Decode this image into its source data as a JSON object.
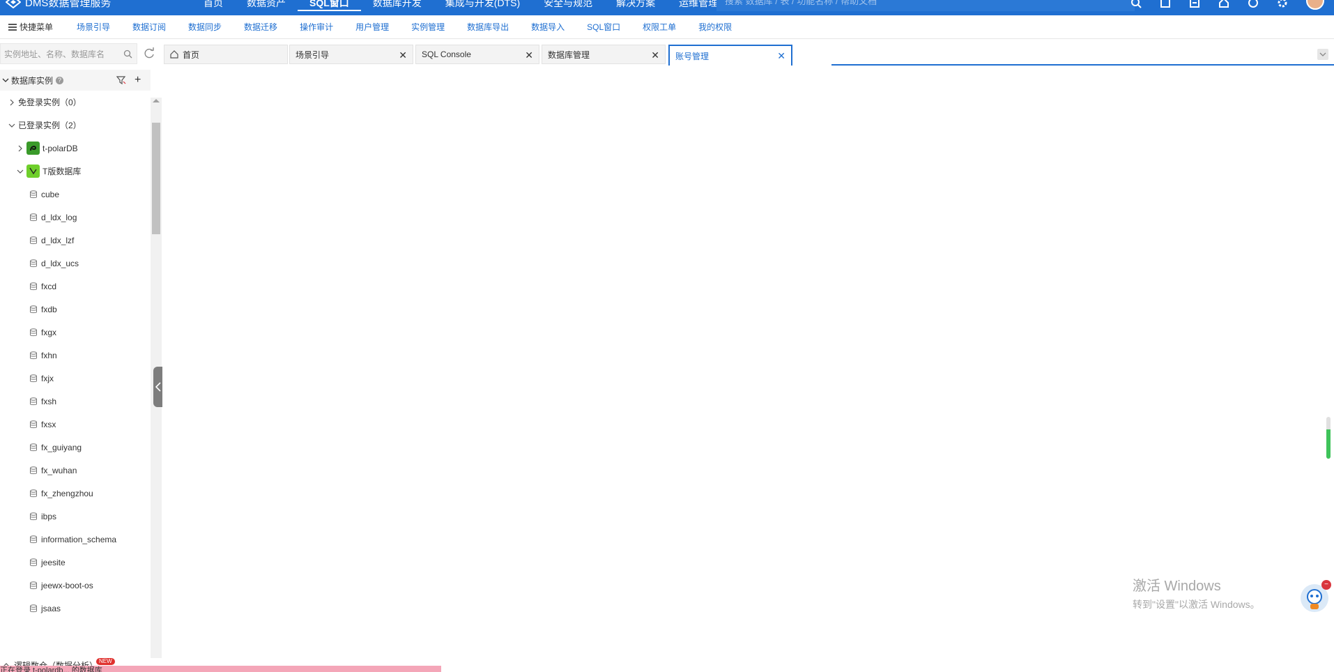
{
  "header": {
    "app_title": "DMS数据管理服务",
    "nav": [
      "首页",
      "数据资产",
      "SQL窗口",
      "数据库开发",
      "集成与开发(DTS)",
      "安全与规范",
      "解决方案",
      "运维管理"
    ],
    "active_nav_index": 2,
    "search_placeholder": "搜索 数据库 / 表 / 功能名称 / 帮助文档"
  },
  "menubar": {
    "quick_label": "快捷菜单",
    "items": [
      "场景引导",
      "数据订阅",
      "数据同步",
      "数据迁移",
      "操作审计",
      "用户管理",
      "实例管理",
      "数据库导出",
      "数据导入",
      "SQL窗口",
      "权限工单",
      "我的权限"
    ]
  },
  "sidebar": {
    "search_placeholder": "实例地址、名称、数据库名",
    "tree_title": "数据库实例",
    "help_mark": "?",
    "groups": [
      {
        "label": "免登录实例（0）"
      },
      {
        "label": "已登录实例（2）"
      }
    ],
    "instances": [
      "t-polarDB",
      "T版数据库"
    ],
    "databases": [
      "cube",
      "d_ldx_log",
      "d_ldx_lzf",
      "d_ldx_ucs",
      "fxcd",
      "fxdb",
      "fxgx",
      "fxhn",
      "fxjx",
      "fxsh",
      "fxsx",
      "fx_guiyang",
      "fx_wuhan",
      "fx_zhengzhou",
      "ibps",
      "information_schema",
      "jeesite",
      "jeewx-boot-os",
      "jsaas"
    ],
    "bottom_item": "逻辑数仓（数据分析）",
    "new_badge": "NEW",
    "pink_bar_text": "正在登录 t-polardb... 的数据库"
  },
  "tabs": [
    {
      "label": "首页",
      "closable": false
    },
    {
      "label": "场景引导",
      "closable": true
    },
    {
      "label": "SQL Console",
      "closable": true
    },
    {
      "label": "数据库管理",
      "closable": true
    },
    {
      "label": "账号管理",
      "closable": true,
      "active": true
    }
  ],
  "watermark": {
    "line1": "激活 Windows",
    "line2": "转到\"设置\"以激活 Windows。"
  },
  "colors": {
    "brand": "#1f6fd1",
    "instance_icon": "#53b82d",
    "scroll_green": "#3fc35a"
  }
}
